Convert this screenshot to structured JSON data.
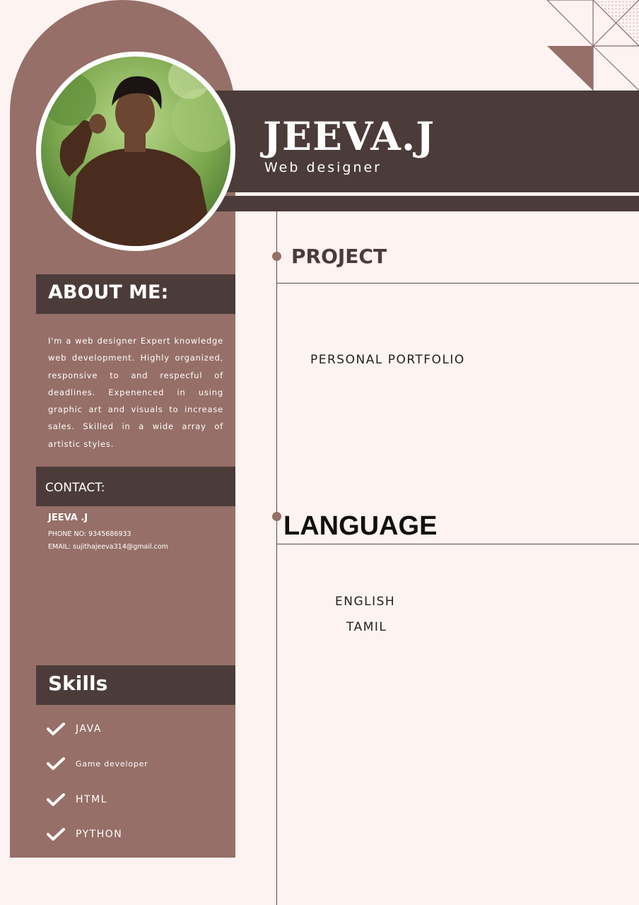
{
  "header": {
    "name": "JEEVA.J",
    "role": "Web designer"
  },
  "about": {
    "heading": "ABOUT ME:",
    "text": "I'm a web designer Expert knowledge web development. Highly organized, responsive to and respecful of deadlines. Expenenced in using graphic art and visuals to increase sales. Skilled in a wide array of artistic styles."
  },
  "contact": {
    "heading": "CONTACT:",
    "name": "JEEVA .J",
    "phone": "PHONE NO: 9345686933",
    "email": "EMAIL: sujithajeeva314@gmail.com"
  },
  "skills": {
    "heading": "Skills",
    "items": [
      "JAVA",
      "Game developer",
      "HTML",
      "PYTHON"
    ]
  },
  "project": {
    "heading": "PROJECT",
    "items": [
      "PERSONAL PORTFOLIO"
    ]
  },
  "language": {
    "heading": "LANGUAGE",
    "items": [
      "ENGLISH",
      "TAMIL"
    ]
  },
  "colors": {
    "sidebar": "#966f68",
    "dark": "#4b3c3a",
    "background": "#fdf3f1"
  }
}
